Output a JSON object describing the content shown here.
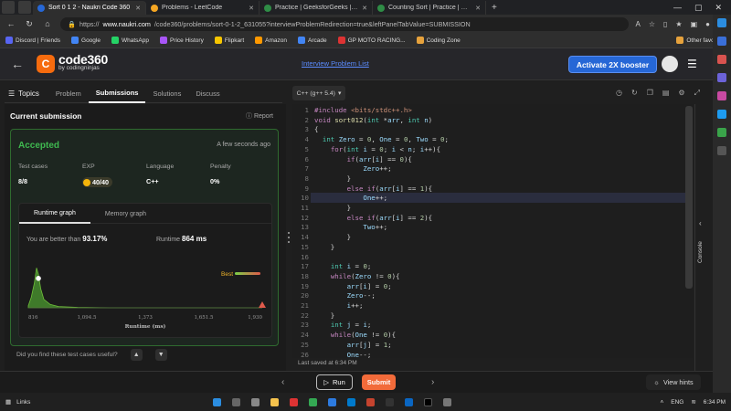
{
  "browser": {
    "tabs": [
      {
        "title": "Sort 0 1 2 - Naukri Code 360",
        "color": "#2667d6",
        "active": true
      },
      {
        "title": "Problems - LeetCode",
        "color": "#f5a623",
        "active": false
      },
      {
        "title": "Practice | GeeksforGeeks | A com",
        "color": "#2f8d46",
        "active": false
      },
      {
        "title": "Counting Sort | Practice | Geeksf",
        "color": "#2f8d46",
        "active": false
      }
    ],
    "new_tab": "+",
    "url_prefix": "https://",
    "url_host": "www.naukri.com",
    "url_path": "/code360/problems/sort-0-1-2_631055?interviewProblemRedirection=true&leftPanelTabValue=SUBMISSION",
    "bookmarks": [
      {
        "label": "Discord | Friends",
        "color": "#5865f2"
      },
      {
        "label": "Google",
        "color": "#4285f4"
      },
      {
        "label": "WhatsApp",
        "color": "#25d366"
      },
      {
        "label": "Price History",
        "color": "#a855f7"
      },
      {
        "label": "Flipkart",
        "color": "#f7c600"
      },
      {
        "label": "Amazon",
        "color": "#ff9900"
      },
      {
        "label": "Arcade",
        "color": "#4285f4"
      },
      {
        "label": "GP MOTO RACING...",
        "color": "#d33"
      },
      {
        "label": "Coding Zone",
        "color": "#e6a23c"
      }
    ],
    "other_favorites": "Other favorites"
  },
  "header": {
    "logo_mark": "C",
    "logo_title": "code360",
    "logo_sub": "by codingninjas",
    "interview_link": "Interview Problem List",
    "activate_button": "Activate 2X booster"
  },
  "left_tabs": {
    "topics": "Topics",
    "items": [
      "Problem",
      "Submissions",
      "Solutions",
      "Discuss"
    ],
    "active": "Submissions"
  },
  "submission": {
    "heading": "Current submission",
    "report": "Report",
    "status": "Accepted",
    "time": "A few seconds ago",
    "stats": [
      {
        "label": "Test cases",
        "value": "8/8"
      },
      {
        "label": "EXP",
        "value": "40/40"
      },
      {
        "label": "Language",
        "value": "C++"
      },
      {
        "label": "Penalty",
        "value": "0%"
      }
    ],
    "graph_tabs": [
      "Runtime graph",
      "Memory graph"
    ],
    "better_prefix": "You are better than",
    "better_value": "93.17%",
    "runtime_prefix": "Runtime",
    "runtime_value": "864 ms",
    "useful_question": "Did you find these test cases useful?"
  },
  "chart_data": {
    "type": "area",
    "x_ticks": [
      "816",
      "1,094.5",
      "1,373",
      "1,651.5",
      "1,930"
    ],
    "xlim": [
      816,
      1930
    ],
    "xlabel": "Runtime (ms)",
    "legend": "Best",
    "marker_you": 864,
    "marker_best": 1930,
    "series": [
      {
        "x": [
          816,
          830,
          845,
          855,
          864,
          875,
          890,
          920,
          960,
          1050,
          1200,
          1400,
          1650,
          1900,
          1930
        ],
        "y": [
          0.05,
          0.25,
          0.6,
          0.95,
          0.8,
          0.45,
          0.2,
          0.08,
          0.03,
          0.01,
          0.0,
          0.0,
          0.0,
          0.0,
          0.0
        ]
      }
    ]
  },
  "editor": {
    "language": "C++ (g++ 5.4)",
    "last_saved": "Last saved at 6:34 PM",
    "highlight_line": 10,
    "lines": [
      "#include <bits/stdc++.h>",
      "void sort012(int *arr, int n)",
      "{",
      "  int Zero = 0, One = 0, Two = 0;",
      "    for(int i = 0; i < n; i++){",
      "        if(arr[i] == 0){",
      "            Zero++;",
      "        }",
      "        else if(arr[i] == 1){",
      "            One++;",
      "        }",
      "        else if(arr[i] == 2){",
      "            Two++;",
      "        }",
      "    }",
      "",
      "    int i = 0;",
      "    while(Zero != 0){",
      "        arr[i] = 0;",
      "        Zero--;",
      "        i++;",
      "    }",
      "    int j = i;",
      "    while(One != 0){",
      "        arr[j] = 1;",
      "        One--;"
    ],
    "console_label": "Console"
  },
  "bottom": {
    "run": "Run",
    "submit": "Submit",
    "hints": "View hints"
  },
  "taskbar": {
    "links": "Links",
    "lang": "ENG",
    "clock": "6:34 PM"
  }
}
